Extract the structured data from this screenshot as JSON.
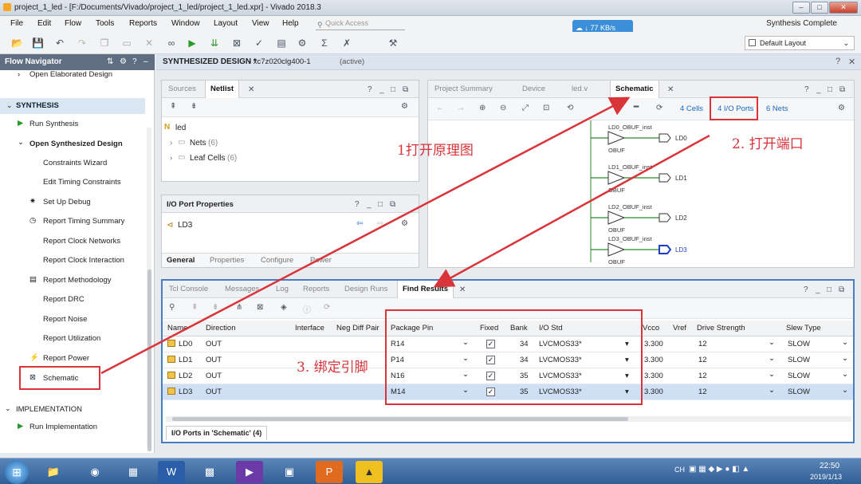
{
  "window": {
    "title": "project_1_led - [F:/Documents/Vivado/project_1_led/project_1_led.xpr] - Vivado 2018.3",
    "minimize": "–",
    "maximize": "□",
    "close": "✕"
  },
  "menu": [
    "File",
    "Edit",
    "Flow",
    "Tools",
    "Reports",
    "Window",
    "Layout",
    "View",
    "Help"
  ],
  "quick_access": {
    "placeholder": "Quick Access"
  },
  "net_speed": "77 KB/s",
  "status": "Synthesis Complete",
  "layout_select": "Default Layout",
  "flow_navigator": {
    "title": "Flow Navigator",
    "items": {
      "open_elab": "Open Elaborated Design",
      "synthesis": "SYNTHESIS",
      "run_synth": "Run Synthesis",
      "open_synth": "Open Synthesized Design",
      "constraints_wizard": "Constraints Wizard",
      "edit_timing": "Edit Timing Constraints",
      "setup_debug": "Set Up Debug",
      "timing_summary": "Report Timing Summary",
      "clock_networks": "Report Clock Networks",
      "clock_interaction": "Report Clock Interaction",
      "methodology": "Report Methodology",
      "drc": "Report DRC",
      "noise": "Report Noise",
      "utilization": "Report Utilization",
      "power": "Report Power",
      "schematic": "Schematic",
      "implementation": "IMPLEMENTATION",
      "run_impl": "Run Implementation"
    }
  },
  "design_header": {
    "name": "SYNTHESIZED DESIGN *",
    "part": "- xc7z020clg400-1",
    "state": "(active)"
  },
  "sources_panel": {
    "tabs": [
      "Sources",
      "Netlist"
    ],
    "root": "led",
    "nets": "Nets",
    "nets_count": "(6)",
    "leaf_cells": "Leaf Cells",
    "leaf_count": "(6)"
  },
  "io_props": {
    "title": "I/O Port Properties",
    "port": "LD3",
    "tabs": [
      "General",
      "Properties",
      "Configure",
      "Power"
    ]
  },
  "schematic_panel": {
    "tabs": [
      "Project Summary",
      "Device",
      "led.v",
      "Schematic"
    ],
    "cells": "4 Cells",
    "ports": "4 I/O Ports",
    "nets": "6 Nets",
    "instances": [
      {
        "inst": "LD0_OBUF_inst",
        "cell": "OBUF",
        "port": "LD0"
      },
      {
        "inst": "LD1_OBUF_inst",
        "cell": "OBUF",
        "port": "LD1"
      },
      {
        "inst": "LD2_OBUF_inst",
        "cell": "OBUF",
        "port": "LD2"
      },
      {
        "inst": "LD3_OBUF_inst",
        "cell": "OBUF",
        "port": "LD3"
      }
    ]
  },
  "bottom_panel": {
    "tabs": [
      "Tcl Console",
      "Messages",
      "Log",
      "Reports",
      "Design Runs",
      "Find Results"
    ],
    "columns": [
      "Name",
      "Direction",
      "Interface",
      "Neg Diff Pair",
      "Package Pin",
      "Fixed",
      "Bank",
      "I/O Std",
      "Vcco",
      "Vref",
      "Drive Strength",
      "Slew Type"
    ],
    "rows": [
      {
        "name": "LD0",
        "dir": "OUT",
        "pin": "R14",
        "bank": "34",
        "std": "LVCMOS33*",
        "vcco": "3.300",
        "drive": "12",
        "slew": "SLOW"
      },
      {
        "name": "LD1",
        "dir": "OUT",
        "pin": "P14",
        "bank": "34",
        "std": "LVCMOS33*",
        "vcco": "3.300",
        "drive": "12",
        "slew": "SLOW"
      },
      {
        "name": "LD2",
        "dir": "OUT",
        "pin": "N16",
        "bank": "35",
        "std": "LVCMOS33*",
        "vcco": "3.300",
        "drive": "12",
        "slew": "SLOW"
      },
      {
        "name": "LD3",
        "dir": "OUT",
        "pin": "M14",
        "bank": "35",
        "std": "LVCMOS33*",
        "vcco": "3.300",
        "drive": "12",
        "slew": "SLOW"
      }
    ],
    "footer_tab": "I/O Ports in 'Schematic' (4)"
  },
  "annotations": {
    "open_schematic": "1打开原理图",
    "open_ports": "2. 打开端口",
    "bind_pins": "3. 绑定引脚"
  },
  "annotation_color": "#d9343a",
  "taskbar": {
    "lang": "CH",
    "time": "22:50",
    "date": "2019/1/13"
  }
}
